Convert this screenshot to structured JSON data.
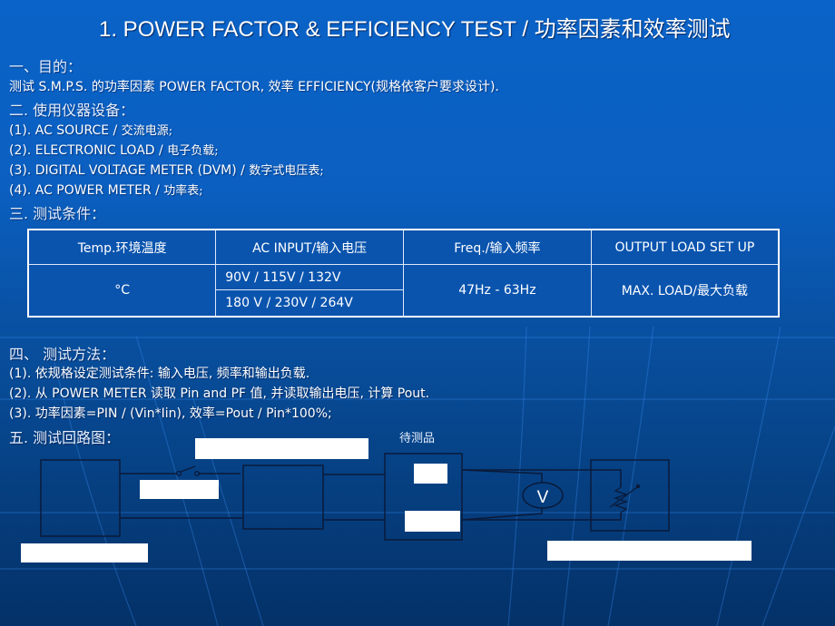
{
  "slide": {
    "title": "1.  POWER FACTOR & EFFICIENCY TEST / 功率因素和效率测试",
    "section1": {
      "heading": "一、目的：",
      "text": "测试 S.M.P.S. 的功率因素 POWER FACTOR, 效率 EFFICIENCY(规格依客户要求设计)."
    },
    "section2": {
      "heading": "二. 使用仪器设备：",
      "items": [
        {
          "prefix": "(1). AC SOURCE / ",
          "zh": "交流电源;"
        },
        {
          "prefix": "(2). ELECTRONIC LOAD / ",
          "zh": "电子负载;"
        },
        {
          "prefix": "(3). DIGITAL VOLTAGE METER (DVM) / ",
          "zh": "数字式电压表;"
        },
        {
          "prefix": "(4). AC POWER METER / ",
          "zh": "功率表;"
        }
      ]
    },
    "section3": {
      "heading": "三. 测试条件：",
      "table": {
        "headers": [
          "Temp.环境温度",
          "AC INPUT/输入电压",
          "Freq./输入频率",
          "OUTPUT LOAD SET UP"
        ],
        "temp": "°C",
        "ac_input": [
          "90V  / 115V / 132V",
          "180 V / 230V / 264V"
        ],
        "freq": "47Hz - 63Hz",
        "load": "MAX. LOAD/最大负载"
      }
    },
    "section4": {
      "heading": "四、 测试方法：",
      "items": [
        "(1). 依规格设定测试条件: 输入电压, 频率和输出负载.",
        "(2). 从 POWER METER 读取 Pin and PF 值, 并读取输出电压, 计算 Pout.",
        "(3). 功率因素=PIN / (Vin*Iin), 效率=Pout / Pin*100%;"
      ]
    },
    "section5": {
      "heading": "五. 测试回路图：",
      "dut_label": "待测品",
      "voltmeter_symbol": "V",
      "icons": [
        "switch-icon",
        "voltmeter-icon",
        "variable-resistor-icon"
      ]
    }
  }
}
